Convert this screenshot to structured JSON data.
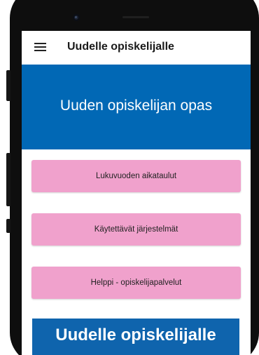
{
  "topbar": {
    "title": "Uudelle opiskelijalle",
    "menu_icon": "hamburger-menu-icon"
  },
  "hero": {
    "title": "Uuden opiskelijan opas",
    "background_color": "#0168b5"
  },
  "menu": {
    "button_color": "#f0a1cc",
    "items": [
      {
        "label": "Lukuvuoden aikataulut"
      },
      {
        "label": "Käytettävät järjestelmät"
      },
      {
        "label": "Helppi - opiskelijapalvelut"
      }
    ]
  },
  "caption": {
    "text": "Uudelle opiskelijalle",
    "background_color": "#0f64ad"
  }
}
